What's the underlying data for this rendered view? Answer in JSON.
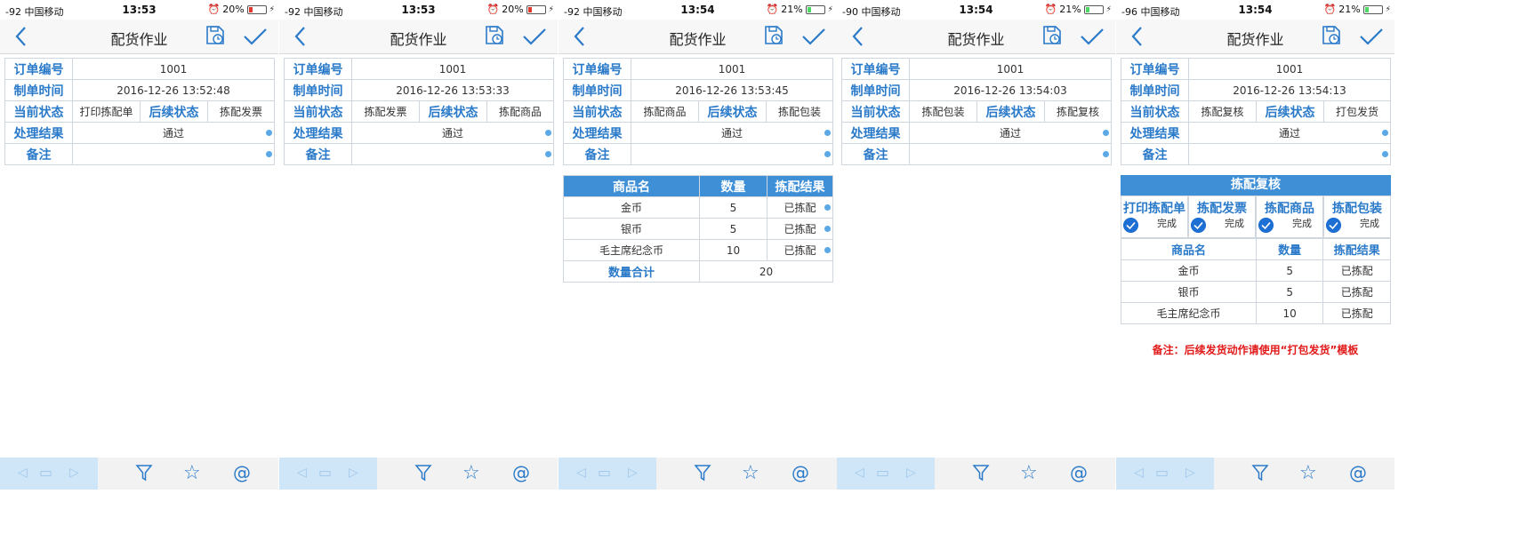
{
  "screens": [
    {
      "status": {
        "signal": "-92 中国移动",
        "time": "13:53",
        "battery": "20%",
        "battery_color": "#e03a2f",
        "battery_level": 0.2
      },
      "title": "配货作业",
      "rows": {
        "order_no": {
          "label": "订单编号",
          "value": "1001"
        },
        "made_time": {
          "label": "制单时间",
          "value": "2016-12-26 13:52:48"
        },
        "state": {
          "label": "当前状态",
          "value": "打印拣配单",
          "next_label": "后续状态",
          "next_value": "拣配发票"
        },
        "result": {
          "label": "处理结果",
          "value": "通过"
        },
        "remark": {
          "label": "备注",
          "value": ""
        }
      }
    },
    {
      "status": {
        "signal": "-92 中国移动",
        "time": "13:53",
        "battery": "20%",
        "battery_color": "#e03a2f",
        "battery_level": 0.2
      },
      "title": "配货作业",
      "rows": {
        "order_no": {
          "label": "订单编号",
          "value": "1001"
        },
        "made_time": {
          "label": "制单时间",
          "value": "2016-12-26 13:53:33"
        },
        "state": {
          "label": "当前状态",
          "value": "拣配发票",
          "next_label": "后续状态",
          "next_value": "拣配商品"
        },
        "result": {
          "label": "处理结果",
          "value": "通过"
        },
        "remark": {
          "label": "备注",
          "value": ""
        }
      }
    },
    {
      "status": {
        "signal": "-92 中国移动",
        "time": "13:54",
        "battery": "21%",
        "battery_color": "#4cd964",
        "battery_level": 0.21
      },
      "title": "配货作业",
      "rows": {
        "order_no": {
          "label": "订单编号",
          "value": "1001"
        },
        "made_time": {
          "label": "制单时间",
          "value": "2016-12-26 13:53:45"
        },
        "state": {
          "label": "当前状态",
          "value": "拣配商品",
          "next_label": "后续状态",
          "next_value": "拣配包装"
        },
        "result": {
          "label": "处理结果",
          "value": "通过"
        },
        "remark": {
          "label": "备注",
          "value": ""
        }
      },
      "goods": {
        "headers": [
          "商品名",
          "数量",
          "拣配结果"
        ],
        "items": [
          {
            "name": "金币",
            "qty": "5",
            "result": "已拣配"
          },
          {
            "name": "银币",
            "qty": "5",
            "result": "已拣配"
          },
          {
            "name": "毛主席纪念币",
            "qty": "10",
            "result": "已拣配"
          }
        ],
        "total_label": "数量合计",
        "total_value": "20"
      }
    },
    {
      "status": {
        "signal": "-90 中国移动",
        "time": "13:54",
        "battery": "21%",
        "battery_color": "#4cd964",
        "battery_level": 0.21
      },
      "title": "配货作业",
      "rows": {
        "order_no": {
          "label": "订单编号",
          "value": "1001"
        },
        "made_time": {
          "label": "制单时间",
          "value": "2016-12-26 13:54:03"
        },
        "state": {
          "label": "当前状态",
          "value": "拣配包装",
          "next_label": "后续状态",
          "next_value": "拣配复核"
        },
        "result": {
          "label": "处理结果",
          "value": "通过"
        },
        "remark": {
          "label": "备注",
          "value": ""
        }
      }
    },
    {
      "status": {
        "signal": "-96 中国移动",
        "time": "13:54",
        "battery": "21%",
        "battery_color": "#4cd964",
        "battery_level": 0.21
      },
      "title": "配货作业",
      "rows": {
        "order_no": {
          "label": "订单编号",
          "value": "1001"
        },
        "made_time": {
          "label": "制单时间",
          "value": "2016-12-26 13:54:13"
        },
        "state": {
          "label": "当前状态",
          "value": "拣配复核",
          "next_label": "后续状态",
          "next_value": "打包发货"
        },
        "result": {
          "label": "处理结果",
          "value": "通过"
        },
        "remark": {
          "label": "备注",
          "value": ""
        }
      },
      "review": {
        "title": "拣配复核",
        "steps": [
          {
            "name": "打印拣配单",
            "status": "完成"
          },
          {
            "name": "拣配发票",
            "status": "完成"
          },
          {
            "name": "拣配商品",
            "status": "完成"
          },
          {
            "name": "拣配包装",
            "status": "完成"
          }
        ],
        "headers": [
          "商品名",
          "数量",
          "拣配结果"
        ],
        "items": [
          {
            "name": "金币",
            "qty": "5",
            "result": "已拣配"
          },
          {
            "name": "银币",
            "qty": "5",
            "result": "已拣配"
          },
          {
            "name": "毛主席纪念币",
            "qty": "10",
            "result": "已拣配"
          }
        ],
        "note": "备注：后续发货动作请使用“打包发货”模板"
      }
    }
  ],
  "colors": {
    "accent": "#2a7ac9",
    "header_blue": "#3e8fd6",
    "note_red": "#e21a1a"
  },
  "icons": {
    "back": "chevron-left-icon",
    "save": "save-clock-icon",
    "confirm": "checkmark-icon",
    "filter": "filter-icon",
    "favorite": "star-icon",
    "mention": "at-icon"
  }
}
